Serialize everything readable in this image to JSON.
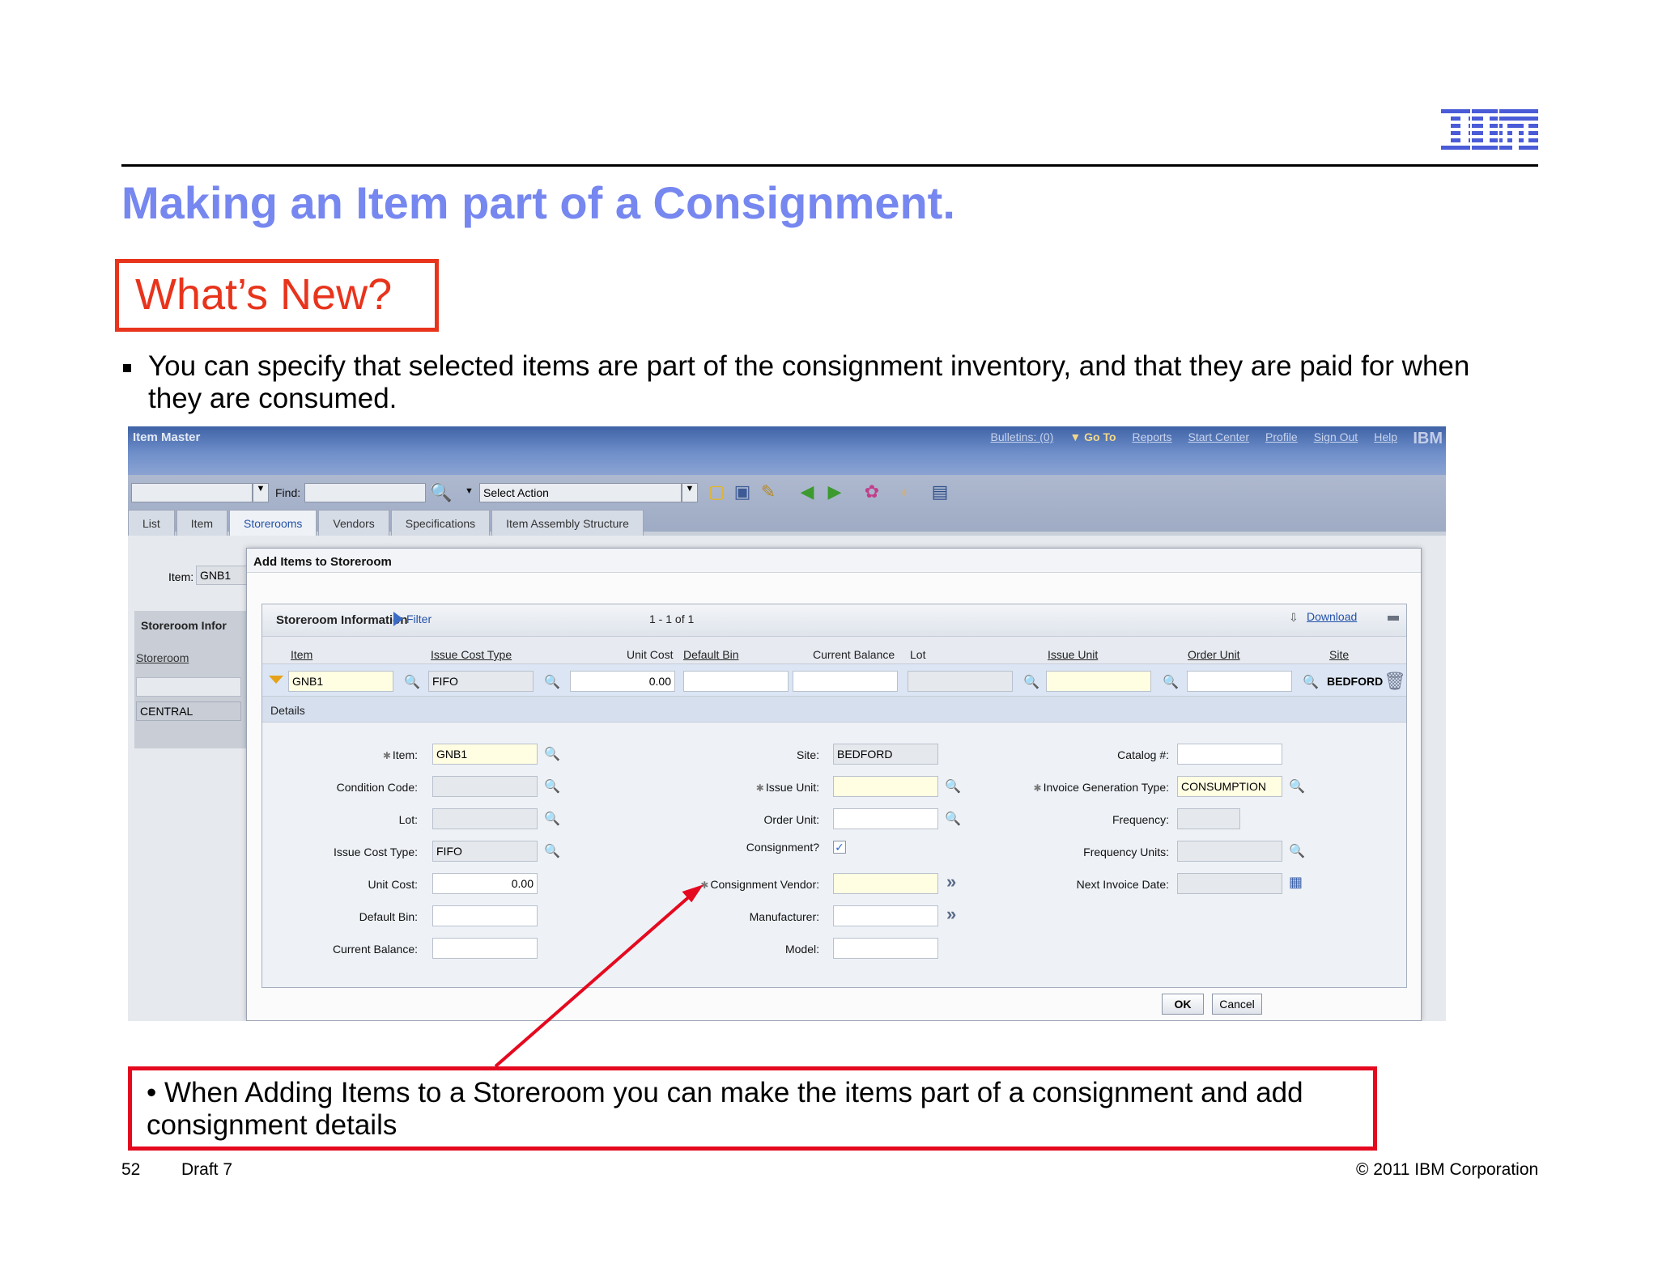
{
  "slide": {
    "title": "Making an Item part of a Consignment.",
    "whats_new": "What’s New?",
    "bullet": "You can specify that selected items are part of the consignment inventory, and that they are paid for when they are consumed.",
    "callout": "• When Adding Items to a Storeroom you can make the items part of a consignment and add consignment details",
    "footer": {
      "page": "52",
      "draft": "Draft 7",
      "copyright": "© 2011 IBM Corporation"
    },
    "logo_text": "IBM",
    "colors": {
      "title": "#7687f0",
      "highlight": "#e8341c",
      "arrow": "#e5091f"
    }
  },
  "app": {
    "title": "Item Master",
    "nav": [
      "Bulletins: (0)",
      "Go To",
      "Reports",
      "Start Center",
      "Profile",
      "Sign Out",
      "Help"
    ],
    "brand": "IBM",
    "toolbar": {
      "find_label": "Find:",
      "select_action": "Select Action"
    },
    "tabs": [
      "List",
      "Item",
      "Storerooms",
      "Vendors",
      "Specifications",
      "Item Assembly Structure"
    ],
    "active_tab": "Storerooms",
    "item_label": "Item:",
    "item_value": "GNB1",
    "left_panel": {
      "title": "Storeroom Infor",
      "column": "Storeroom",
      "row": "CENTRAL"
    },
    "dialog": {
      "title": "Add Items to Storeroom",
      "table": {
        "title": "Storeroom Information",
        "filter": "Filter",
        "count": "1 - 1 of 1",
        "download": "Download",
        "columns": [
          "Item",
          "Issue Cost Type",
          "Unit Cost",
          "Default Bin",
          "Current Balance",
          "Lot",
          "Issue Unit",
          "Order Unit",
          "Site"
        ],
        "row": {
          "item": "GNB1",
          "issue_cost_type": "FIFO",
          "unit_cost": "0.00",
          "default_bin": "",
          "current_balance": "",
          "lot": "",
          "issue_unit": "",
          "order_unit": "",
          "site": "BEDFORD"
        }
      },
      "details_label": "Details",
      "details": {
        "item": {
          "label": "Item:",
          "value": "GNB1"
        },
        "condition_code": {
          "label": "Condition Code:",
          "value": ""
        },
        "lot": {
          "label": "Lot:",
          "value": ""
        },
        "issue_cost_type": {
          "label": "Issue Cost Type:",
          "value": "FIFO"
        },
        "unit_cost": {
          "label": "Unit Cost:",
          "value": "0.00"
        },
        "default_bin": {
          "label": "Default Bin:",
          "value": ""
        },
        "current_balance": {
          "label": "Current Balance:",
          "value": ""
        },
        "site": {
          "label": "Site:",
          "value": "BEDFORD"
        },
        "issue_unit": {
          "label": "Issue Unit:",
          "value": ""
        },
        "order_unit": {
          "label": "Order Unit:",
          "value": ""
        },
        "consignment": {
          "label": "Consignment?",
          "value": "✓"
        },
        "consignment_vendor": {
          "label": "Consignment Vendor:",
          "value": ""
        },
        "manufacturer": {
          "label": "Manufacturer:",
          "value": ""
        },
        "model": {
          "label": "Model:",
          "value": ""
        },
        "catalog": {
          "label": "Catalog #:",
          "value": ""
        },
        "invoice_generation_type": {
          "label": "Invoice Generation Type:",
          "value": "CONSUMPTION"
        },
        "frequency": {
          "label": "Frequency:",
          "value": ""
        },
        "frequency_units": {
          "label": "Frequency Units:",
          "value": ""
        },
        "next_invoice_date": {
          "label": "Next Invoice Date:",
          "value": ""
        }
      },
      "buttons": {
        "ok": "OK",
        "cancel": "Cancel"
      }
    }
  }
}
